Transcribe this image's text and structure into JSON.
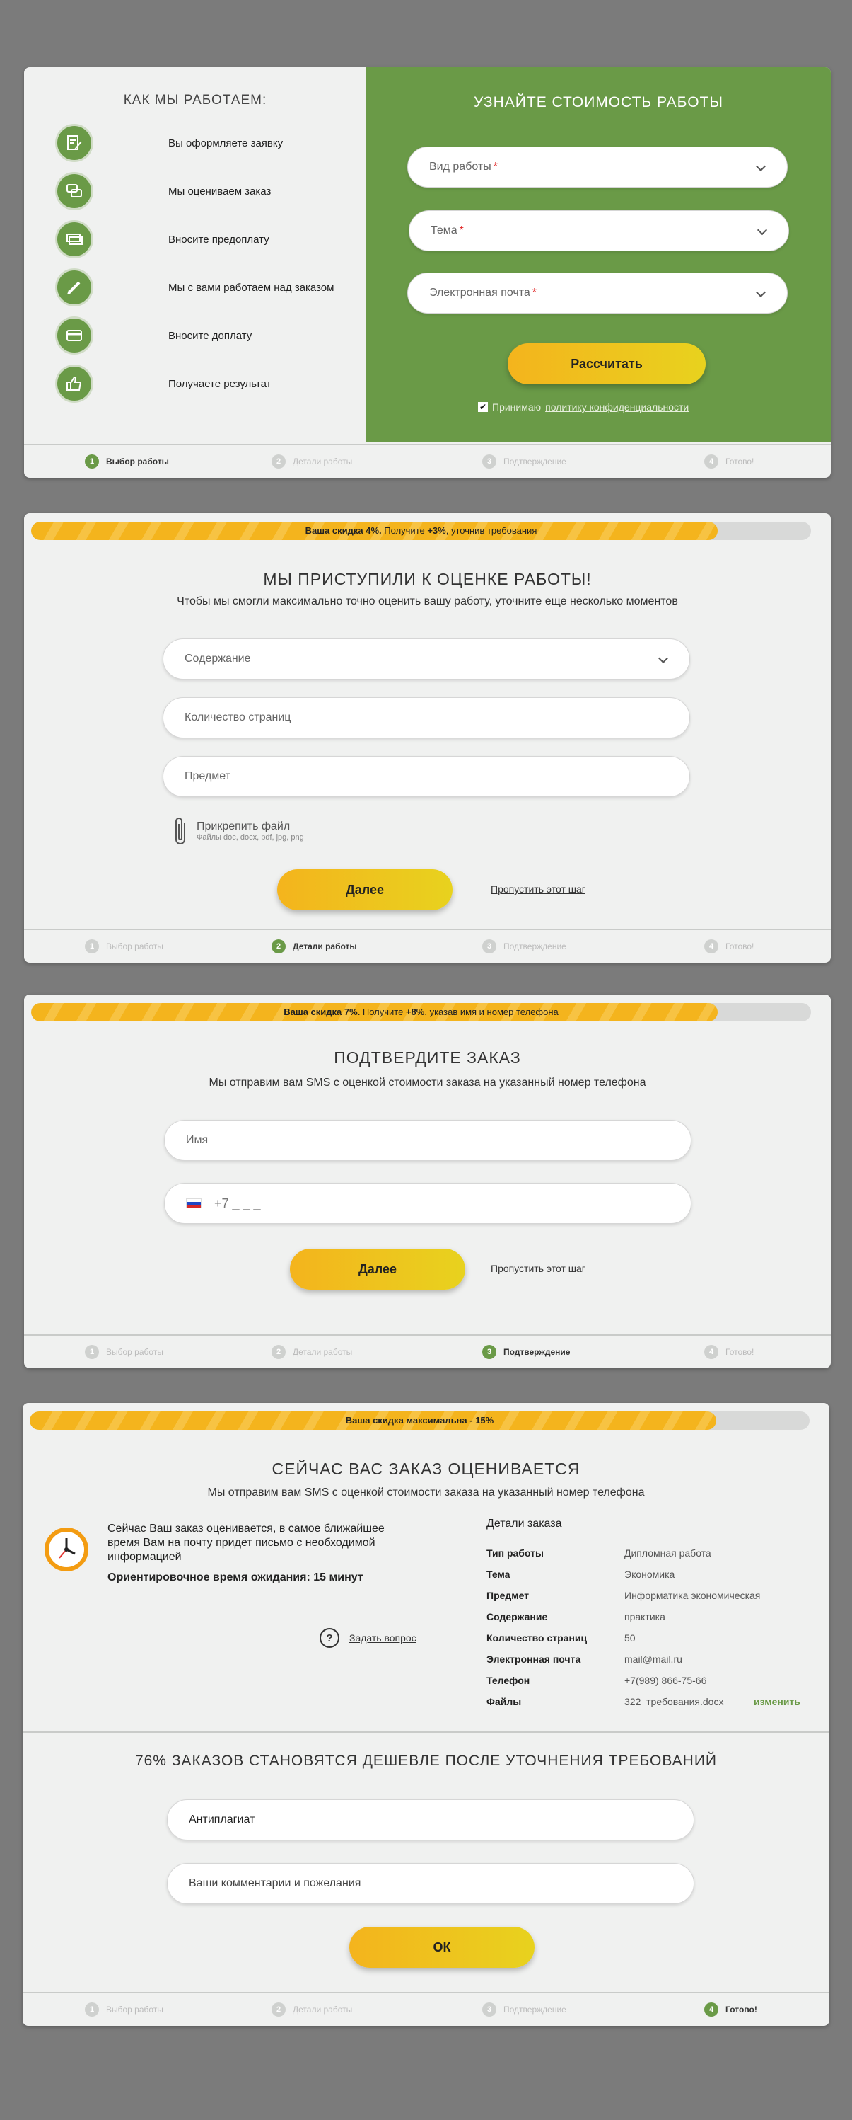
{
  "card1": {
    "how_title": "КАК МЫ РАБОТАЕМ:",
    "how_items": [
      {
        "label": "Вы оформляете заявку",
        "icon": "document-pen-icon"
      },
      {
        "label": "Мы оцениваем заказ",
        "icon": "chat-bubbles-icon"
      },
      {
        "label": "Вносите предоплату",
        "icon": "money-icon"
      },
      {
        "label": "Мы с вами работаем над заказом",
        "icon": "pencil-icon"
      },
      {
        "label": "Вносите доплату",
        "icon": "credit-card-icon"
      },
      {
        "label": "Получаете результат",
        "icon": "thumbs-up-icon"
      }
    ],
    "form_title": "УЗНАЙТЕ СТОИМОСТЬ РАБОТЫ",
    "work_type_placeholder": "Вид работы",
    "topic_placeholder": "Тема",
    "email_placeholder": "Электронная почта",
    "required_mark": "*",
    "calc_button": "Рассчитать",
    "consent_prefix": "Принимаю",
    "consent_link": "политику конфиденциальности"
  },
  "steps": {
    "s1": {
      "num": "1",
      "label": "Выбор работы"
    },
    "s2": {
      "num": "2",
      "label": "Детали работы"
    },
    "s3": {
      "num": "3",
      "label": "Подтверждение"
    },
    "s4": {
      "num": "4",
      "label": "Готово!"
    }
  },
  "card2": {
    "progress_bold1": "Ваша скидка 4%.",
    "progress_mid": " Получите ",
    "progress_bold2": "+3%",
    "progress_tail": ", уточнив требования",
    "progress_fill": 0.88,
    "title": "МЫ ПРИСТУПИЛИ К ОЦЕНКЕ РАБОТЫ!",
    "subtitle": "Чтобы мы смогли максимально точно оценить вашу работу, уточните еще несколько моментов",
    "content_placeholder": "Содержание",
    "pages_placeholder": "Количество страниц",
    "subject_placeholder": "Предмет",
    "attach_label": "Прикрепить файл",
    "attach_hint": "Файлы doc, docx, pdf, jpg, png",
    "next_button": "Далее",
    "skip_link": "Пропустить этот шаг"
  },
  "card3": {
    "progress_bold1": "Ваша скидка 7%.",
    "progress_mid": " Получите ",
    "progress_bold2": "+8%",
    "progress_tail": ", указав имя и номер телефона",
    "progress_fill": 0.88,
    "title": "ПОДТВЕРДИТЕ ЗАКАЗ",
    "subtitle": "Мы отправим вам SMS с оценкой стоимости заказа на указанный номер телефона",
    "name_placeholder": "Имя",
    "phone_placeholder": "+7 _ _ _",
    "next_button": "Далее",
    "skip_link": "Пропустить этот шаг"
  },
  "card4": {
    "progress_text": "Ваша скидка максимальна - 15%",
    "progress_fill": 0.88,
    "title": "СЕЙЧАС ВАС ЗАКАЗ ОЦЕНИВАЕТСЯ",
    "subtitle": "Мы отправим вам SMS с оценкой стоимости заказа на указанный номер телефона",
    "status_text": "Сейчас Ваш заказ оценивается, в самое ближайшее время Вам на почту придет письмо с необходимой информацией",
    "wait_text": "Ориентировочное время ожидания: 15 минут",
    "ask_link": "Задать вопрос",
    "details_title": "Детали заказа",
    "details": [
      {
        "k": "Тип работы",
        "v": "Дипломная работа"
      },
      {
        "k": "Тема",
        "v": "Экономика"
      },
      {
        "k": "Предмет",
        "v": "Информатика экономическая"
      },
      {
        "k": "Содержание",
        "v": "практика"
      },
      {
        "k": "Количество страниц",
        "v": "50"
      },
      {
        "k": "Электронная почта",
        "v": "mail@mail.ru"
      },
      {
        "k": "Телефон",
        "v": "+7(989) 866-75-66"
      },
      {
        "k": "Файлы",
        "v": "322_требования.docx"
      }
    ],
    "change_link": "изменить",
    "promo_title": "76% ЗАКАЗОВ СТАНОВЯТСЯ ДЕШЕВЛЕ ПОСЛЕ УТОЧНЕНИЯ ТРЕБОВАНИЙ",
    "antiplag_placeholder": "Антиплагиат",
    "comments_placeholder": "Ваши комментарии и пожелания",
    "ok_button": "ОК"
  },
  "colors": {
    "green": "#6a9a47",
    "yellow": "#f4b41d",
    "bg": "#7b7b7b"
  }
}
